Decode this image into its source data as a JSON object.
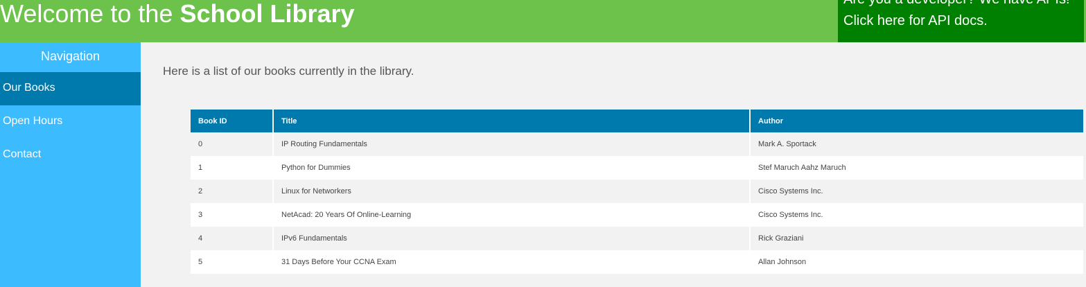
{
  "header": {
    "title_prefix": "Welcome to the ",
    "title_strong": "School Library",
    "api_line1": "Are you a developer? We have APIs!",
    "api_line2": "Click here for API docs."
  },
  "sidebar": {
    "heading": "Navigation",
    "items": [
      {
        "label": "Our Books"
      },
      {
        "label": "Open Hours"
      },
      {
        "label": "Contact"
      }
    ]
  },
  "main": {
    "intro": "Here is a list of our books currently in the library.",
    "table": {
      "headers": [
        "Book ID",
        "Title",
        "Author"
      ],
      "rows": [
        [
          "0",
          "IP Routing Fundamentals",
          "Mark A. Sportack"
        ],
        [
          "1",
          "Python for Dummies",
          "Stef Maruch Aahz Maruch"
        ],
        [
          "2",
          "Linux for Networkers",
          "Cisco Systems Inc."
        ],
        [
          "3",
          "NetAcad: 20 Years Of Online-Learning",
          "Cisco Systems Inc."
        ],
        [
          "4",
          "IPv6 Fundamentals",
          "Rick Graziani"
        ],
        [
          "5",
          "31 Days Before Your CCNA Exam",
          "Allan Johnson"
        ]
      ]
    }
  },
  "colors": {
    "header_bg": "#6cc24a",
    "api_bg": "#008000",
    "sidebar_bg": "#3dbbff",
    "active_nav_bg": "#007aad",
    "table_header_bg": "#007aad"
  }
}
